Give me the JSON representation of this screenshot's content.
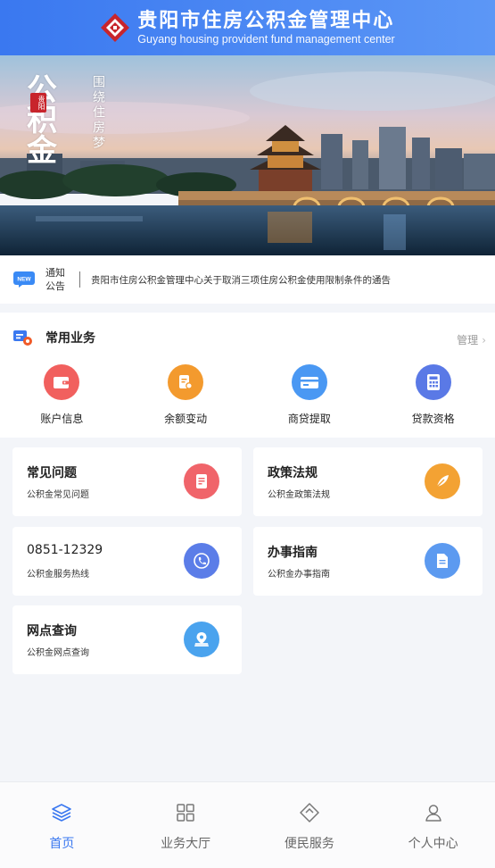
{
  "header": {
    "title_cn": "贵阳市住房公积金管理中心",
    "title_en": "Guyang housing provident fund management center"
  },
  "banner": {
    "calligraphy_main": "公积金",
    "seal": "贵阳",
    "calligraphy_side": "围绕住房梦"
  },
  "notice": {
    "tag_line1": "通知",
    "tag_line2": "公告",
    "text": "贵阳市住房公积金管理中心关于取消三项住房公积金使用限制条件的通告"
  },
  "services": {
    "title": "常用业务",
    "manage": "管理",
    "items": [
      {
        "label": "账户信息",
        "color": "#f1605e"
      },
      {
        "label": "余额变动",
        "color": "#f39a2e"
      },
      {
        "label": "商贷提取",
        "color": "#4a98f3"
      },
      {
        "label": "贷款资格",
        "color": "#5a79e6"
      }
    ]
  },
  "cards": [
    {
      "title": "常见问题",
      "sub": "公积金常见问题"
    },
    {
      "title": "政策法规",
      "sub": "公积金政策法规"
    },
    {
      "title": "0851-12329",
      "sub": "公积金服务热线"
    },
    {
      "title": "办事指南",
      "sub": "公积金办事指南"
    },
    {
      "title": "网点查询",
      "sub": "公积金网点查询"
    }
  ],
  "nav": [
    {
      "label": "首页",
      "active": true
    },
    {
      "label": "业务大厅",
      "active": false
    },
    {
      "label": "便民服务",
      "active": false
    },
    {
      "label": "个人中心",
      "active": false
    }
  ],
  "colors": {
    "brand": "#3a78f0",
    "logo_red": "#c8252c"
  }
}
